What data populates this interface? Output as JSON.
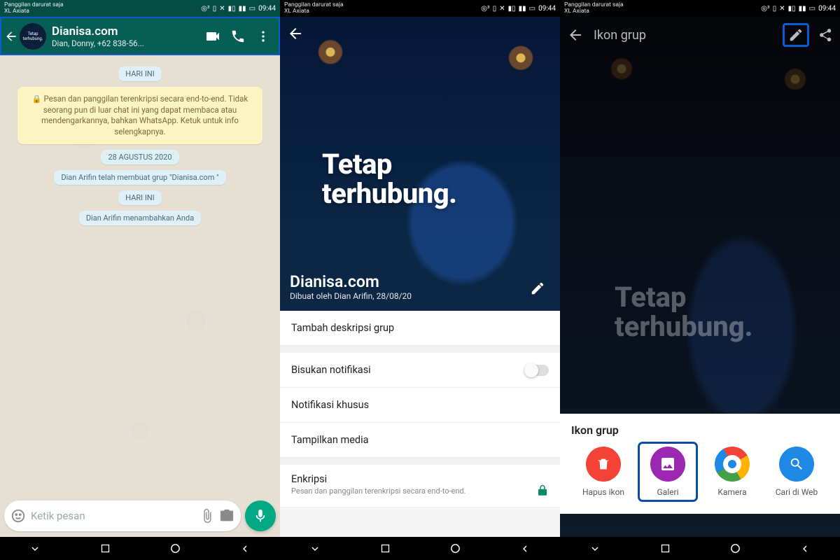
{
  "status": {
    "line1": "Panggilan darurat saja",
    "line2": "XL Axiata",
    "time": "09:44"
  },
  "screen1": {
    "title": "Dianisa.com",
    "subtitle": "Dian, Donny, +62 838-56...",
    "date_today": "HARI INI",
    "encryption": "Pesan dan panggilan terenkripsi secara end-to-end. Tidak seorang pun di luar chat ini yang dapat membaca atau mendengarkannya, bahkan WhatsApp. Ketuk untuk info selengkapnya.",
    "date_past": "28 AGUSTUS 2020",
    "sys_created": "Dian Arifin telah membuat grup \"Dianisa.com \"",
    "date_today2": "HARI INI",
    "sys_added": "Dian Arifin menambahkan Anda",
    "input_placeholder": "Ketik pesan"
  },
  "screen2": {
    "hero_line1": "Tetap",
    "hero_line2": "terhubung.",
    "group_name": "Dianisa.com",
    "created_by": "Dibuat oleh Dian Arifin, 28/08/20",
    "add_desc": "Tambah deskripsi grup",
    "mute": "Bisukan notifikasi",
    "custom_notif": "Notifikasi khusus",
    "show_media": "Tampilkan media",
    "encryption_title": "Enkripsi",
    "encryption_sub": "Pesan dan panggilan terenkripsi secara end-to-end."
  },
  "screen3": {
    "title": "Ikon grup",
    "hero_line1": "Tetap",
    "hero_line2": "terhubung.",
    "sheet_title": "Ikon grup",
    "opt_remove": "Hapus ikon",
    "opt_gallery": "Galeri",
    "opt_camera": "Kamera",
    "opt_web": "Cari di Web"
  }
}
